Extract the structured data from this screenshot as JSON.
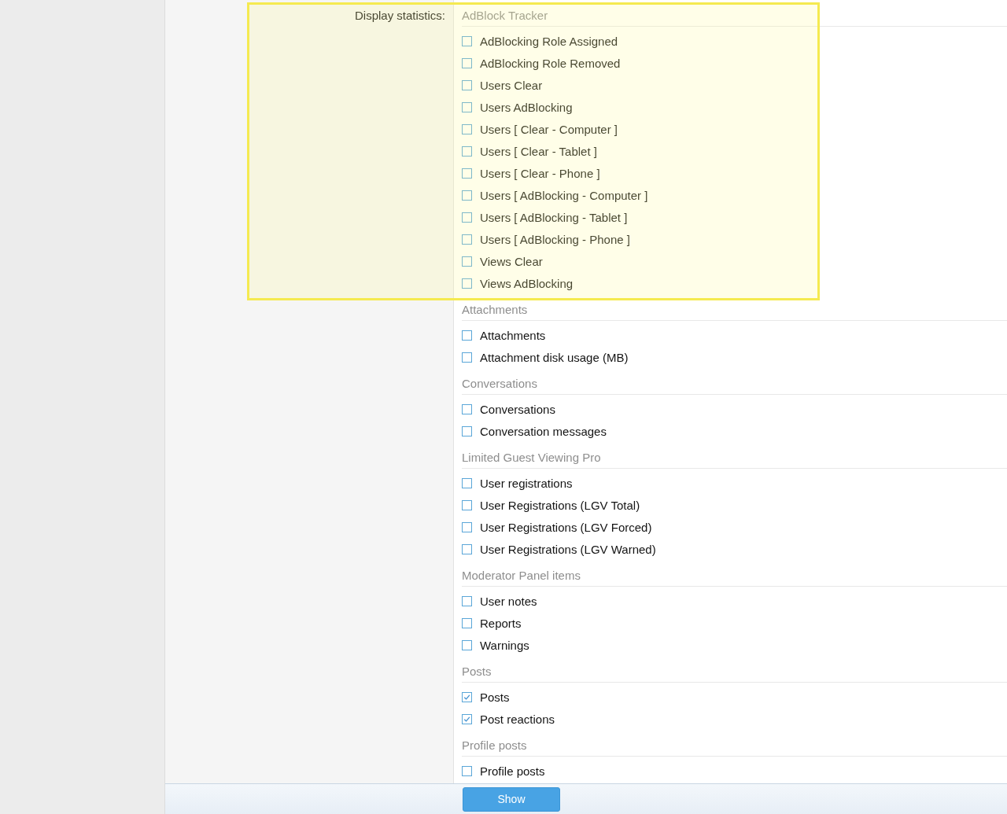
{
  "form": {
    "label": "Display statistics:",
    "groups": [
      {
        "title": "AdBlock Tracker",
        "highlighted": true,
        "items": [
          {
            "label": "AdBlocking Role Assigned",
            "checked": false
          },
          {
            "label": "AdBlocking Role Removed",
            "checked": false
          },
          {
            "label": "Users Clear",
            "checked": false
          },
          {
            "label": "Users AdBlocking",
            "checked": false
          },
          {
            "label": "Users [ Clear - Computer ]",
            "checked": false
          },
          {
            "label": "Users [ Clear - Tablet ]",
            "checked": false
          },
          {
            "label": "Users [ Clear - Phone ]",
            "checked": false
          },
          {
            "label": "Users [ AdBlocking - Computer ]",
            "checked": false
          },
          {
            "label": "Users [ AdBlocking - Tablet ]",
            "checked": false
          },
          {
            "label": "Users [ AdBlocking - Phone ]",
            "checked": false
          },
          {
            "label": "Views Clear",
            "checked": false
          },
          {
            "label": "Views AdBlocking",
            "checked": false
          }
        ]
      },
      {
        "title": "Attachments",
        "highlighted": false,
        "items": [
          {
            "label": "Attachments",
            "checked": false
          },
          {
            "label": "Attachment disk usage (MB)",
            "checked": false
          }
        ]
      },
      {
        "title": "Conversations",
        "highlighted": false,
        "items": [
          {
            "label": "Conversations",
            "checked": false
          },
          {
            "label": "Conversation messages",
            "checked": false
          }
        ]
      },
      {
        "title": "Limited Guest Viewing Pro",
        "highlighted": false,
        "items": [
          {
            "label": "User registrations",
            "checked": false
          },
          {
            "label": "User Registrations (LGV Total)",
            "checked": false
          },
          {
            "label": "User Registrations (LGV Forced)",
            "checked": false
          },
          {
            "label": "User Registrations (LGV Warned)",
            "checked": false
          }
        ]
      },
      {
        "title": "Moderator Panel items",
        "highlighted": false,
        "items": [
          {
            "label": "User notes",
            "checked": false
          },
          {
            "label": "Reports",
            "checked": false
          },
          {
            "label": "Warnings",
            "checked": false
          }
        ]
      },
      {
        "title": "Posts",
        "highlighted": false,
        "items": [
          {
            "label": "Posts",
            "checked": true
          },
          {
            "label": "Post reactions",
            "checked": true
          }
        ]
      },
      {
        "title": "Profile posts",
        "highlighted": false,
        "items": [
          {
            "label": "Profile posts",
            "checked": false
          }
        ]
      }
    ]
  },
  "submit": {
    "label": "Show"
  }
}
